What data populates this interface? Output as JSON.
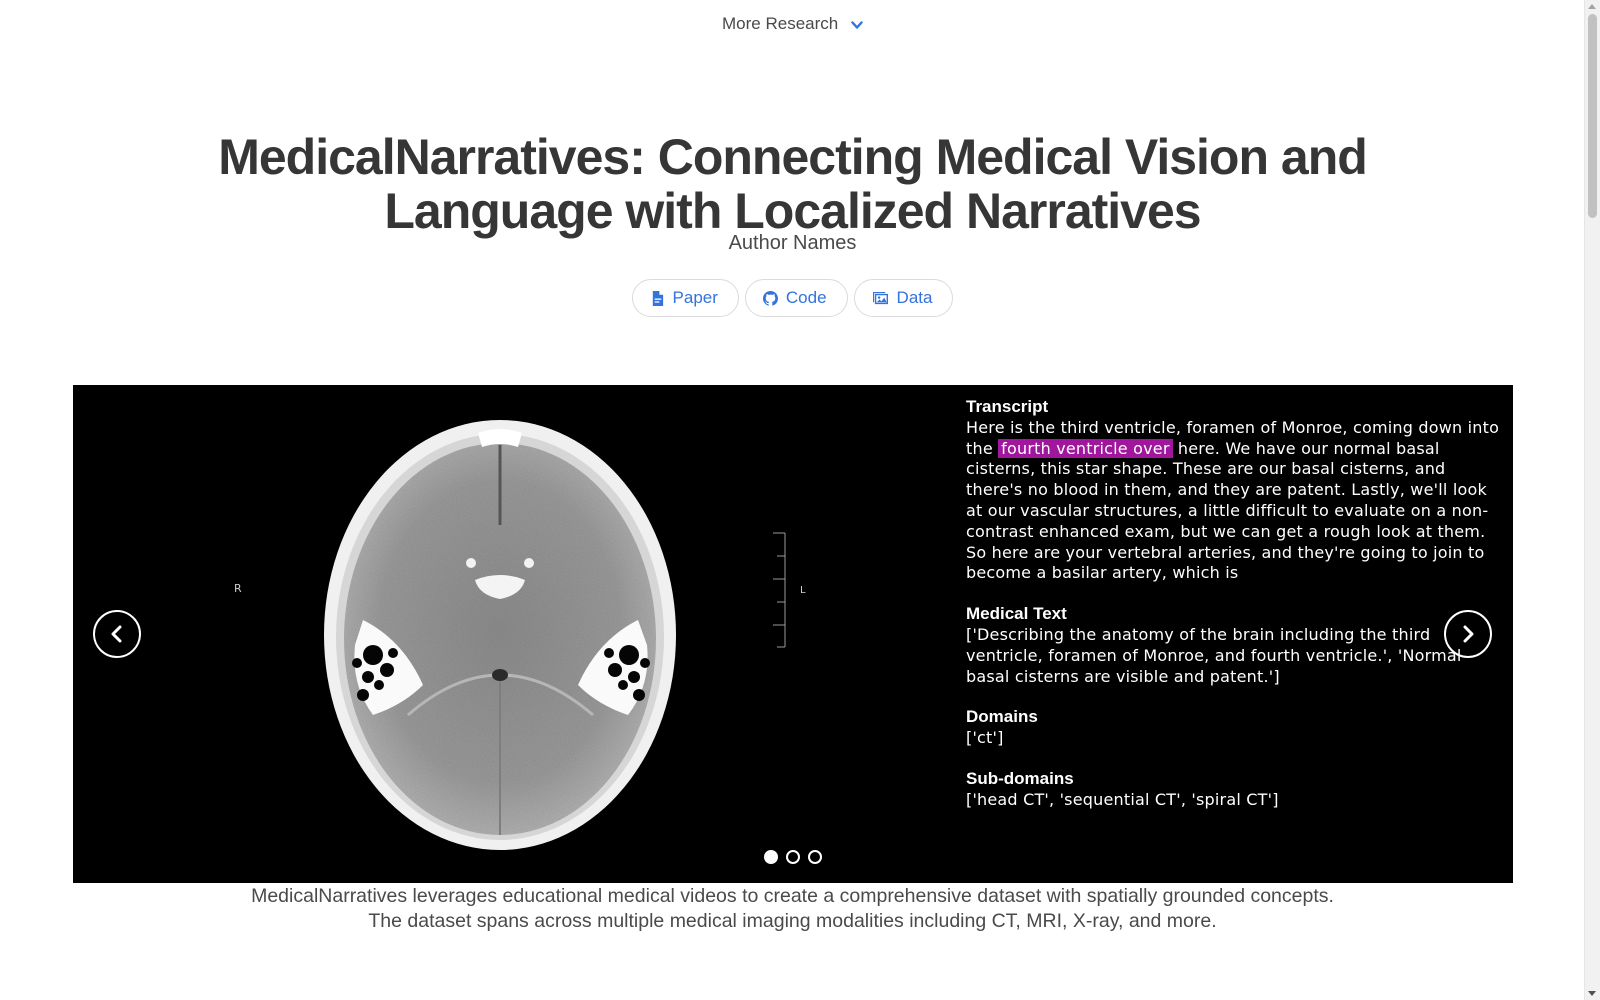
{
  "nav": {
    "more_research_label": "More Research"
  },
  "title": "MedicalNarratives: Connecting Medical Vision and Language with Localized Narratives",
  "authors": "Author Names",
  "links": [
    {
      "label": "Paper",
      "icon": "pdf-icon"
    },
    {
      "label": "Code",
      "icon": "github-icon"
    },
    {
      "label": "Data",
      "icon": "images-icon"
    }
  ],
  "carousel": {
    "scan_labels": {
      "right": "R",
      "left": "L"
    },
    "transcript_heading": "Transcript",
    "transcript_before": "Here is the third ventricle, foramen of Monroe, coming down into the ",
    "transcript_highlight": "fourth ventricle over",
    "transcript_after": " here. We have our normal basal cisterns, this star shape. These are our basal cisterns, and there's no blood in them, and they are patent. Lastly, we'll look at our vascular structures, a little difficult to evaluate on a non-contrast enhanced exam, but we can get a rough look at them. So here are your vertebral arteries, and they're going to join to become a basilar artery, which is",
    "medical_text_heading": "Medical Text",
    "medical_text": "['Describing the anatomy of the brain including the third ventricle, foramen of Monroe, and fourth ventricle.', 'Normal basal cisterns are visible and patent.']",
    "domains_heading": "Domains",
    "domains": "['ct']",
    "subdomains_heading": "Sub-domains",
    "subdomains": "['head CT', 'sequential CT', 'spiral CT']",
    "highlight_color": "#a0179d",
    "slide_count": 3,
    "active_slide": 1
  },
  "caption": "MedicalNarratives leverages educational medical videos to create a comprehensive dataset with spatially grounded concepts. The dataset spans across multiple medical imaging modalities including CT, MRI, X-ray, and more.",
  "colors": {
    "link": "#3273dc",
    "text": "#363636"
  }
}
